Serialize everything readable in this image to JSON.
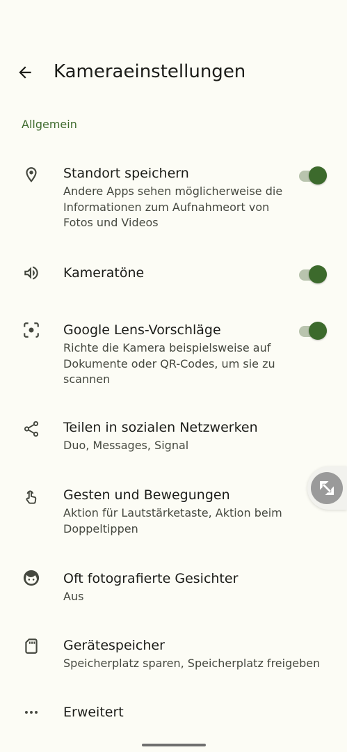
{
  "header": {
    "back_icon": "arrow-back-icon",
    "title": "Kameraeinstellungen"
  },
  "section": {
    "label": "Allgemein"
  },
  "items": [
    {
      "icon": "location-pin-icon",
      "title": "Standort speichern",
      "subtitle": "Andere Apps sehen möglicherweise die Informationen zum Aufnahmeort von Fotos und Videos",
      "toggle": true
    },
    {
      "icon": "speaker-icon",
      "title": "Kameratöne",
      "subtitle": "",
      "toggle": true
    },
    {
      "icon": "lens-icon",
      "title": "Google Lens-Vorschläge",
      "subtitle": "Richte die Kamera beispielsweise auf Dokumente oder QR-Codes, um sie zu scannen",
      "toggle": true
    },
    {
      "icon": "share-icon",
      "title": "Teilen in sozialen Netzwerken",
      "subtitle": "Duo, Messages, Signal"
    },
    {
      "icon": "gesture-touch-icon",
      "title": "Gesten und Bewegungen",
      "subtitle": "Aktion für Lautstärketaste, Aktion beim Doppeltippen"
    },
    {
      "icon": "face-icon",
      "title": "Oft fotografierte Gesichter",
      "subtitle": "Aus"
    },
    {
      "icon": "sd-card-icon",
      "title": "Gerätespeicher",
      "subtitle": "Speicherplatz sparen, Speicherplatz freigeben"
    },
    {
      "icon": "more-horiz-icon",
      "title": "Erweitert",
      "subtitle": ""
    }
  ],
  "floating_button": {
    "icon": "screenshot-tool-icon"
  },
  "colors": {
    "background": "#fcfcf5",
    "accent": "#3c6a2c",
    "section_label": "#3f6b2e",
    "toggle_track": "#b9c4ae"
  }
}
